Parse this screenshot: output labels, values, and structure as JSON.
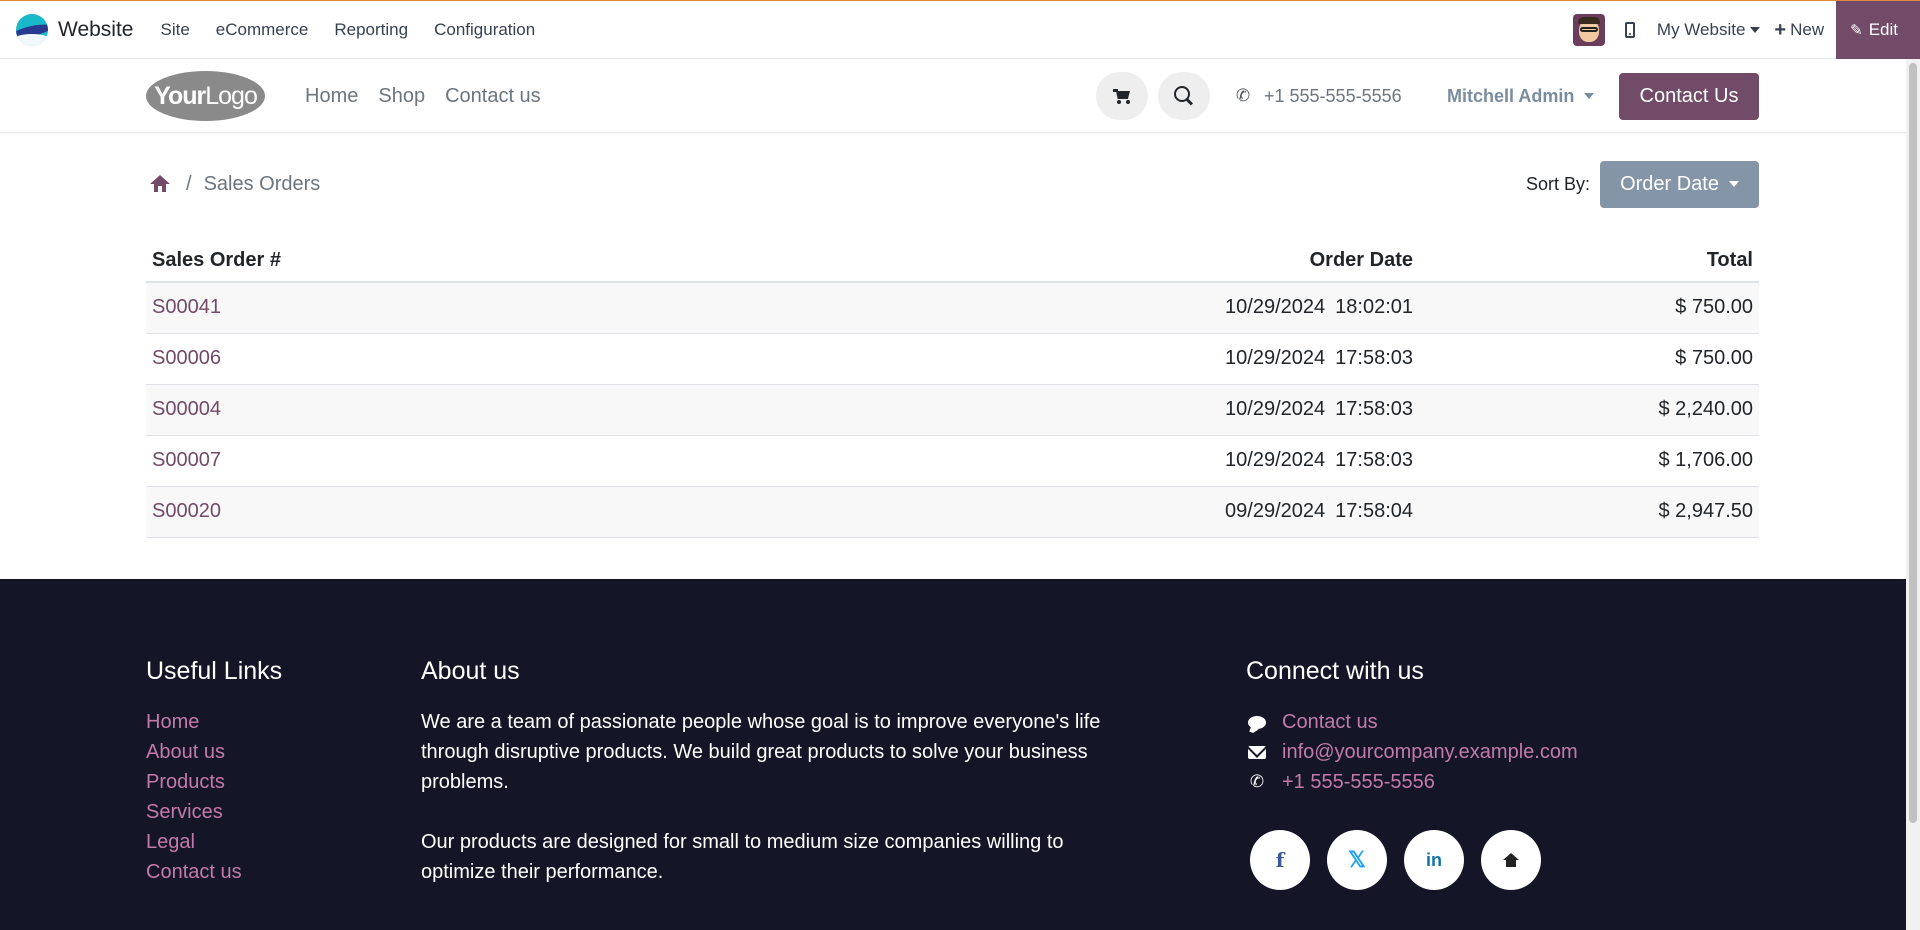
{
  "admin_bar": {
    "app_name": "Website",
    "menu": [
      "Site",
      "eCommerce",
      "Reporting",
      "Configuration"
    ],
    "website_selector": "My Website",
    "new_label": "New",
    "edit_label": "Edit",
    "accent_color": "#714b67"
  },
  "header": {
    "logo_bold": "Your",
    "logo_light": "Logo",
    "nav": [
      "Home",
      "Shop",
      "Contact us"
    ],
    "phone": "+1 555-555-5556",
    "user_name": "Mitchell Admin",
    "contact_button": "Contact Us"
  },
  "page": {
    "breadcrumb_current": "Sales Orders",
    "breadcrumb_separator": "/",
    "sort_label": "Sort By:",
    "sort_value": "Order Date"
  },
  "orders_table": {
    "columns": [
      "Sales Order #",
      "Order Date",
      "Total"
    ],
    "rows": [
      {
        "number": "S00041",
        "date": "10/29/2024",
        "time": "18:02:01",
        "total": "$ 750.00"
      },
      {
        "number": "S00006",
        "date": "10/29/2024",
        "time": "17:58:03",
        "total": "$ 750.00"
      },
      {
        "number": "S00004",
        "date": "10/29/2024",
        "time": "17:58:03",
        "total": "$ 2,240.00"
      },
      {
        "number": "S00007",
        "date": "10/29/2024",
        "time": "17:58:03",
        "total": "$ 1,706.00"
      },
      {
        "number": "S00020",
        "date": "09/29/2024",
        "time": "17:58:04",
        "total": "$ 2,947.50"
      }
    ]
  },
  "footer": {
    "useful_links_title": "Useful Links",
    "useful_links": [
      "Home",
      "About us",
      "Products",
      "Services",
      "Legal",
      "Contact us"
    ],
    "about_title": "About us",
    "about_p1": "We are a team of passionate people whose goal is to improve everyone's life through disruptive products. We build great products to solve your business problems.",
    "about_p2": "Our products are designed for small to medium size companies willing to optimize their performance.",
    "connect_title": "Connect with us",
    "connect_items": {
      "contact": "Contact us",
      "email": "info@yourcompany.example.com",
      "phone": "+1 555-555-5556"
    },
    "socials": [
      "facebook-icon",
      "x-twitter-icon",
      "linkedin-icon",
      "home-icon"
    ]
  }
}
